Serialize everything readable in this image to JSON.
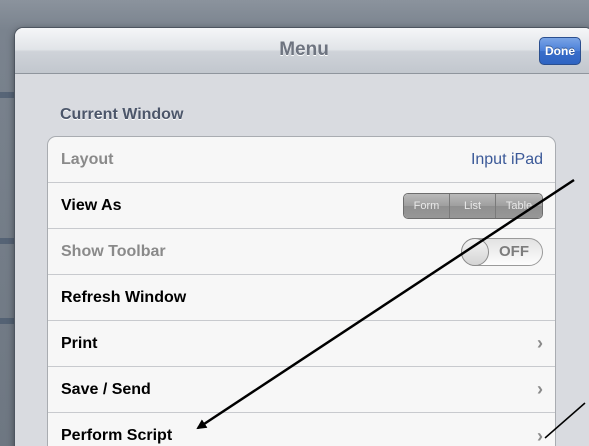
{
  "navbar": {
    "title": "Menu",
    "done_label": "Done"
  },
  "section": {
    "header": "Current Window"
  },
  "rows": [
    {
      "label": "Layout",
      "value": "Input iPad"
    },
    {
      "label": "View As",
      "segments": [
        "Form",
        "List",
        "Table"
      ]
    },
    {
      "label": "Show Toolbar",
      "toggle": "OFF"
    },
    {
      "label": "Refresh Window"
    },
    {
      "label": "Print",
      "chevron": "›"
    },
    {
      "label": "Save / Send",
      "chevron": "›"
    },
    {
      "label": "Perform Script",
      "chevron": "›"
    }
  ],
  "colors": {
    "accent": "#3b5998",
    "done_button": "#3a6fcb",
    "arrow": "#000000"
  },
  "icons": [
    "chevron-right-icon",
    "annotation-arrow"
  ]
}
